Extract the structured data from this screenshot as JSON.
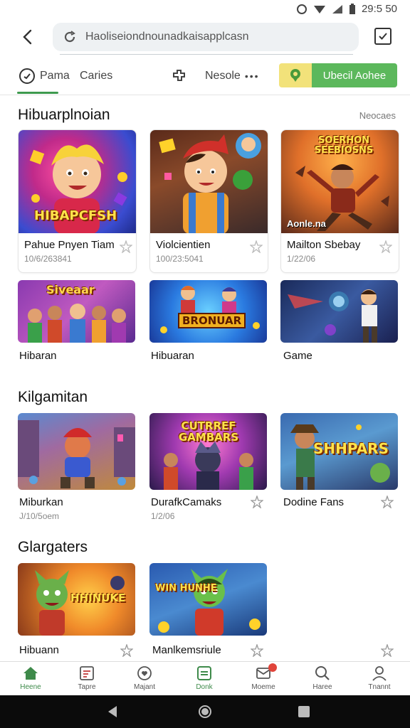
{
  "status": {
    "time": "29:5 50"
  },
  "topbar": {
    "url": "Haoliseiondnounadkaisapplcasn"
  },
  "tabs": [
    {
      "label": "Pama"
    },
    {
      "label": "Caries"
    },
    {
      "label": "Nesole"
    }
  ],
  "promo": {
    "label": "Ubecil Aohee"
  },
  "sections": [
    {
      "title": "Hibuarplnoian",
      "more": "Neocaes",
      "cards": [
        {
          "title": "Pahue Pnyen Tiam",
          "sub": "10/6/263841",
          "art": "HIBAPCFSH"
        },
        {
          "title": "Violcientien",
          "sub": "100/23:5041",
          "art": ""
        },
        {
          "title": "Mailton Sbebay",
          "sub": "1/22/06",
          "art": "SOERHON SEEBIOSNS"
        },
        {
          "title": "Hibaran",
          "art": "Siveaar"
        },
        {
          "title": "Hibuaran",
          "art": "BRONUAR"
        },
        {
          "title": "Game",
          "art": ""
        }
      ]
    },
    {
      "title": "Kilgamitan",
      "cards": [
        {
          "title": "Miburkan",
          "sub": "J/10/5oem"
        },
        {
          "title": "DurafkCamaks",
          "sub": "1/2/06",
          "art": "CUTRREF GAMBARS"
        },
        {
          "title": "Dodine Fans",
          "art": "SHHPARS"
        }
      ]
    },
    {
      "title": "Glargaters",
      "cards": [
        {
          "title": "Hibuann",
          "art": "HHINUKE"
        },
        {
          "title": "Manlkemsriule",
          "art": "WIN HUNHE"
        }
      ]
    }
  ],
  "bottom_nav": [
    {
      "label": "Heene"
    },
    {
      "label": "Tapre"
    },
    {
      "label": "Majant"
    },
    {
      "label": "Donk"
    },
    {
      "label": "Moeme"
    },
    {
      "label": "Haree"
    },
    {
      "label": "Tnannt"
    }
  ]
}
